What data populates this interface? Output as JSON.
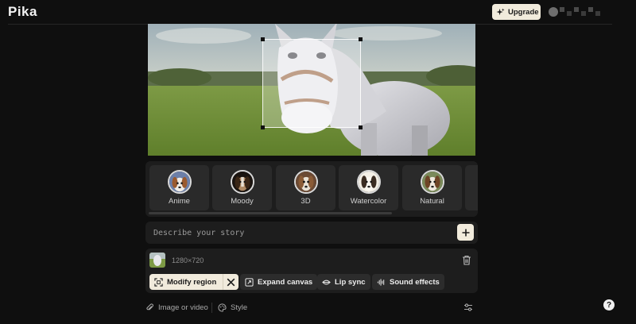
{
  "header": {
    "logo": "Pika",
    "upgrade_label": "Upgrade"
  },
  "styles": {
    "items": [
      {
        "label": "Anime"
      },
      {
        "label": "Moody"
      },
      {
        "label": "3D"
      },
      {
        "label": "Watercolor"
      },
      {
        "label": "Natural"
      }
    ]
  },
  "prompt": {
    "placeholder": "Describe your story",
    "value": ""
  },
  "media": {
    "dimensions": "1280×720"
  },
  "tools": {
    "modify_region": "Modify region",
    "expand_canvas": "Expand canvas",
    "lip_sync": "Lip sync",
    "sound_effects": "Sound effects"
  },
  "footer": {
    "image_or_video": "Image or video",
    "style": "Style",
    "help": "?"
  },
  "colors": {
    "background": "#0f0f0f",
    "panel": "#1d1d1d",
    "accent": "#f1ebdc"
  },
  "icons": [
    "sparkle-icon",
    "plus-icon",
    "trash-icon",
    "modify-region-icon",
    "close-icon",
    "expand-canvas-icon",
    "lip-sync-icon",
    "sound-effects-icon",
    "paperclip-icon",
    "palette-icon",
    "settings-sliders-icon"
  ]
}
